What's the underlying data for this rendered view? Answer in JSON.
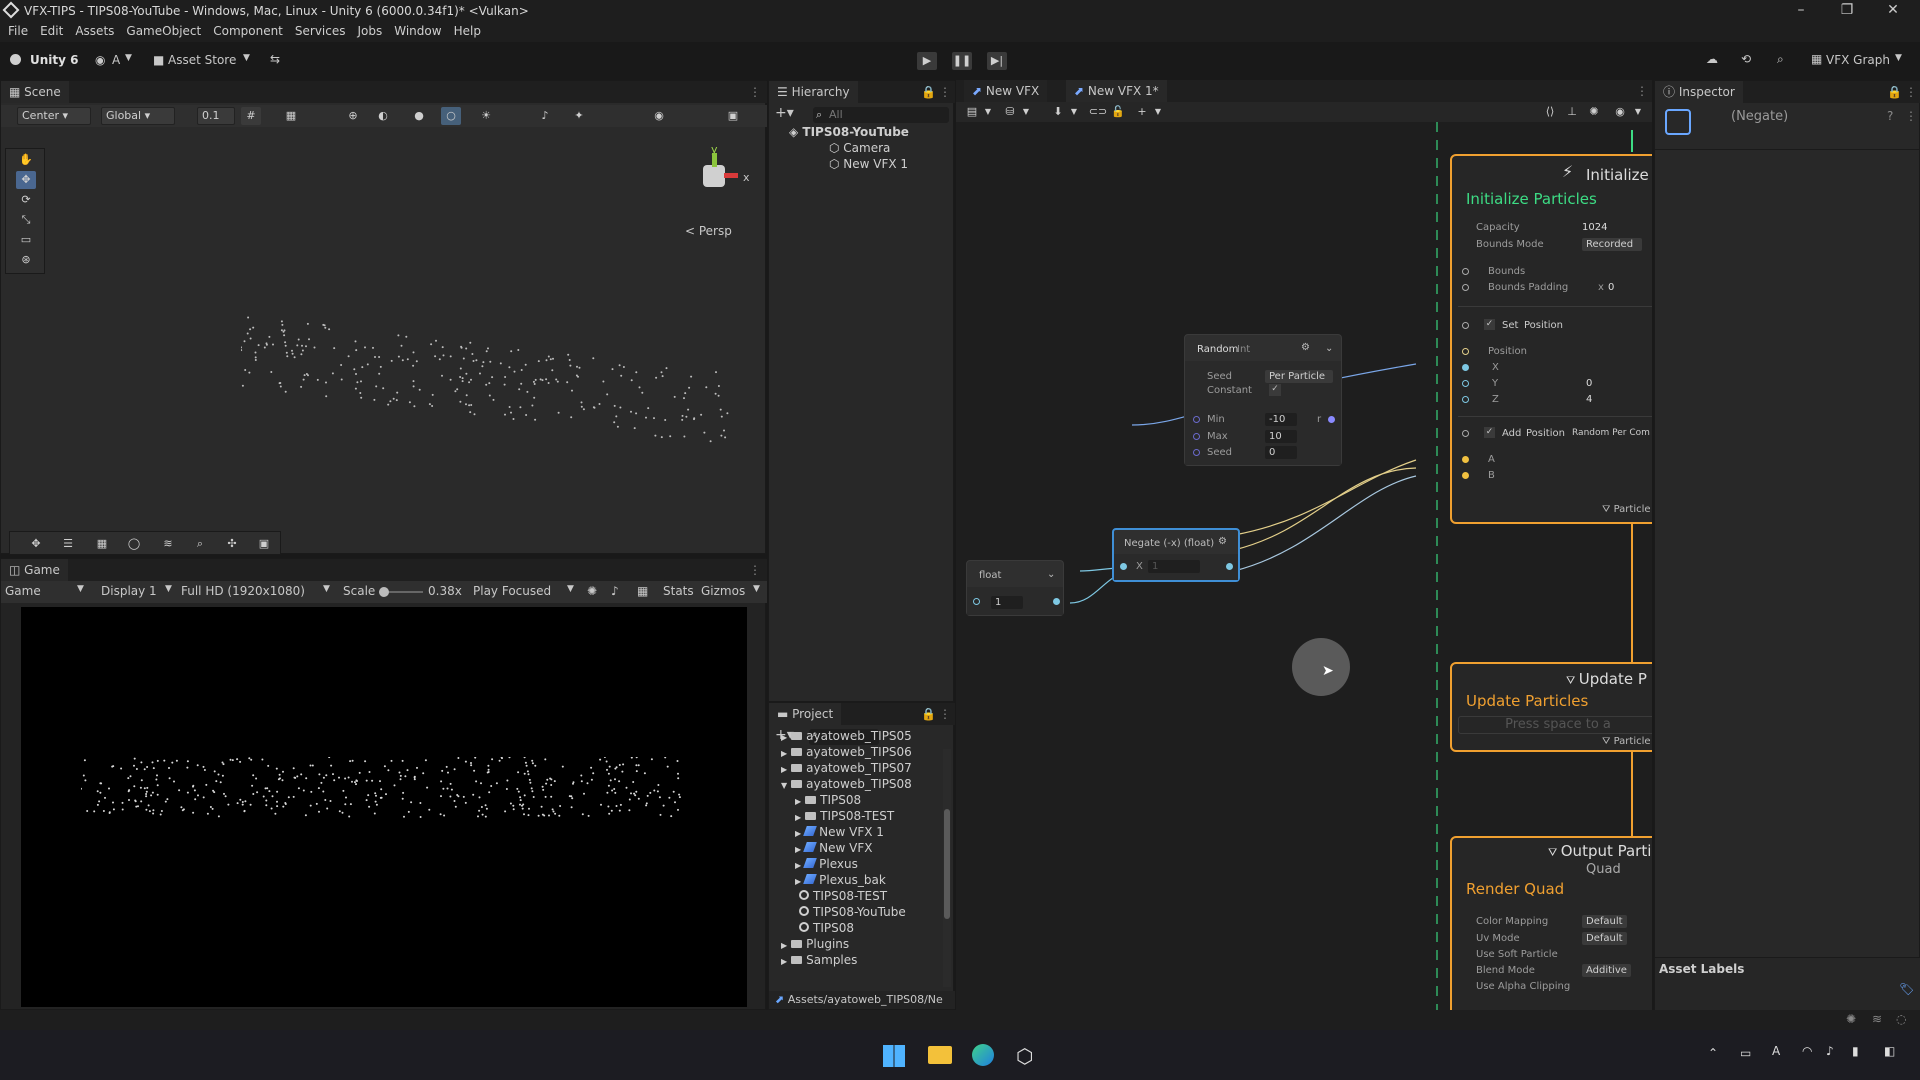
{
  "window": {
    "title": "VFX-TIPS - TIPS08-YouTube - Windows, Mac, Linux - Unity 6 (6000.0.34f1)* <Vulkan>"
  },
  "menu": [
    "File",
    "Edit",
    "Assets",
    "GameObject",
    "Component",
    "Services",
    "Jobs",
    "Window",
    "Help"
  ],
  "toolbar": {
    "unity": "Unity 6",
    "account": "A",
    "asset_store": "Asset Store",
    "vfx_graph": "VFX Graph"
  },
  "scene": {
    "tab": "Scene",
    "pivot": "Center",
    "space": "Global",
    "snap": "0.1",
    "persp": "< Persp",
    "gizmo_axes": [
      "y",
      "x"
    ]
  },
  "game": {
    "tab": "Game",
    "mode": "Game",
    "display": "Display 1",
    "resolution": "Full HD (1920x1080)",
    "scale_label": "Scale",
    "scale_value": "0.38x",
    "play_mode": "Play Focused",
    "stats": "Stats",
    "gizmos": "Gizmos"
  },
  "hierarchy": {
    "tab": "Hierarchy",
    "search": "All",
    "root": "TIPS08-YouTube",
    "items": [
      "Camera",
      "New VFX 1"
    ]
  },
  "vfx": {
    "tabs": [
      "New VFX",
      "New VFX 1*"
    ],
    "random": {
      "title": "Random",
      "type": "Int",
      "seed_label": "Seed",
      "seed_mode": "Per Particle",
      "constant_label": "Constant",
      "min_label": "Min",
      "min": "-10",
      "max_label": "Max",
      "max": "10",
      "seed2_label": "Seed",
      "seed2": "0",
      "out": "r"
    },
    "float": {
      "title": "float",
      "value": "1"
    },
    "negate": {
      "title": "Negate (-x) (float)",
      "x_label": "X",
      "x": "1"
    },
    "init": {
      "title": "Initialize",
      "subtitle": "Initialize Particles",
      "capacity_label": "Capacity",
      "capacity": "1024",
      "bounds_mode_label": "Bounds Mode",
      "bounds_mode": "Recorded",
      "bounds": "Bounds",
      "padding": "Bounds Padding",
      "padding_x": "x",
      "padding_v": "0",
      "set_label": "Set",
      "set_attr": "Position",
      "position": "Position",
      "x": "X",
      "y": "Y",
      "y_val": "0",
      "z": "Z",
      "z_val": "4",
      "add_label": "Add",
      "add_attr": "Position",
      "add_mode": "Random Per Com",
      "a": "A",
      "b": "B",
      "particle": "Particle"
    },
    "update": {
      "title": "Update P",
      "subtitle": "Update Particles",
      "placeholder": "Press space to a",
      "particle": "Particle"
    },
    "output": {
      "title": "Output Parti",
      "sub": "Quad",
      "subtitle": "Render Quad",
      "rows": [
        [
          "Color Mapping",
          "Default"
        ],
        [
          "Uv Mode",
          "Default"
        ],
        [
          "Use Soft Particle",
          ""
        ],
        [
          "Blend Mode",
          "Additive"
        ],
        [
          "Use Alpha Clipping",
          ""
        ]
      ]
    }
  },
  "project": {
    "tab": "Project",
    "items": [
      {
        "name": "ayatoweb_TIPS05",
        "kind": "folder",
        "depth": 1
      },
      {
        "name": "ayatoweb_TIPS06",
        "kind": "folder",
        "depth": 1
      },
      {
        "name": "ayatoweb_TIPS07",
        "kind": "folder",
        "depth": 1
      },
      {
        "name": "ayatoweb_TIPS08",
        "kind": "folder",
        "depth": 1
      },
      {
        "name": "TIPS08",
        "kind": "folder",
        "depth": 2
      },
      {
        "name": "TIPS08-TEST",
        "kind": "folder",
        "depth": 2
      },
      {
        "name": "New VFX 1",
        "kind": "vfx",
        "depth": 2
      },
      {
        "name": "New VFX",
        "kind": "vfx",
        "depth": 2
      },
      {
        "name": "Plexus",
        "kind": "vfx",
        "depth": 2
      },
      {
        "name": "Plexus_bak",
        "kind": "vfx",
        "depth": 2
      },
      {
        "name": "TIPS08-TEST",
        "kind": "scene",
        "depth": 2
      },
      {
        "name": "TIPS08-YouTube",
        "kind": "scene",
        "depth": 2
      },
      {
        "name": "TIPS08",
        "kind": "scene",
        "depth": 2
      },
      {
        "name": "Plugins",
        "kind": "folder",
        "depth": 1
      },
      {
        "name": "Samples",
        "kind": "folder",
        "depth": 1
      }
    ],
    "path": "Assets/ayatoweb_TIPS08/Ne"
  },
  "inspector": {
    "tab": "Inspector",
    "object": "(Negate)",
    "asset_labels": "Asset Labels"
  }
}
